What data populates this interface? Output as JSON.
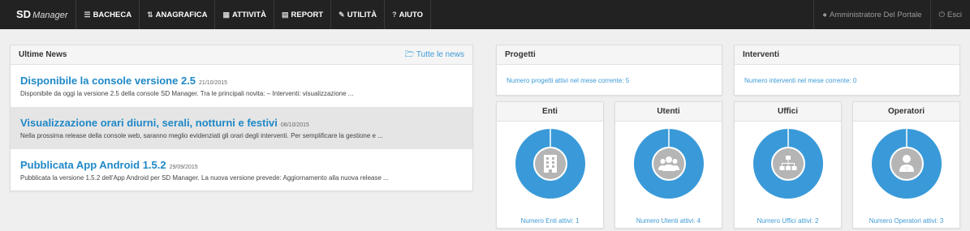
{
  "nav": {
    "brand_main": "SD",
    "brand_sub": "Manager",
    "items": [
      {
        "icon": "☰",
        "icon_name": "list-icon",
        "label": "BACHECA"
      },
      {
        "icon": "⇅",
        "icon_name": "sort-icon",
        "label": "ANAGRAFICA"
      },
      {
        "icon": "▦",
        "icon_name": "calendar-icon",
        "label": "ATTIVITÀ"
      },
      {
        "icon": "▤",
        "icon_name": "chart-icon",
        "label": "REPORT"
      },
      {
        "icon": "✎",
        "icon_name": "wrench-icon",
        "label": "UTILITÀ"
      },
      {
        "icon": "?",
        "icon_name": "help-icon",
        "label": "AIUTO"
      }
    ],
    "user": {
      "icon": "●",
      "label": "Amministratore Del Portale"
    },
    "logout": {
      "icon": "⏻",
      "label": "Esci"
    }
  },
  "news": {
    "title": "Ultime News",
    "all_link": "Tutte le news",
    "items": [
      {
        "title": "Disponibile la console versione 2.5",
        "date": "21/10/2015",
        "text": "Disponibile da oggi la versione 2.5 della console SD Manager. Tra le principali novita: – Interventi: visualizzazione ..."
      },
      {
        "title": "Visualizzazione orari diurni, serali, notturni e festivi",
        "date": "08/10/2015",
        "text": "Nella prossima release della console web, saranno meglio evidenziati gli orari degli interventi. Per semplificare la gestione e ..."
      },
      {
        "title": "Pubblicata App Android 1.5.2",
        "date": "29/09/2015",
        "text": "Pubblicata la versione 1.5.2 dell'App Android per SD Manager. La nuova versione prevede: Aggiornamento alla nuova release ..."
      }
    ]
  },
  "progetti": {
    "title": "Progetti",
    "text": "Numero progetti attivi nel mese corrente: 5"
  },
  "interventi": {
    "title": "Interventi",
    "text": "Numero interventi nel mese corrente: 0"
  },
  "stats": [
    {
      "title": "Enti",
      "icon": "building-icon",
      "text": "Numero Enti attivi: 1"
    },
    {
      "title": "Utenti",
      "icon": "users-icon",
      "text": "Numero Utenti attivi: 4"
    },
    {
      "title": "Uffici",
      "icon": "sitemap-icon",
      "text": "Numero Uffici attivi: 2"
    },
    {
      "title": "Operatori",
      "icon": "user-md-icon",
      "text": "Numero Operatori attivi: 3"
    }
  ],
  "colors": {
    "accent": "#3a9ad9",
    "navbar": "#222222",
    "link": "#1e88c7"
  }
}
